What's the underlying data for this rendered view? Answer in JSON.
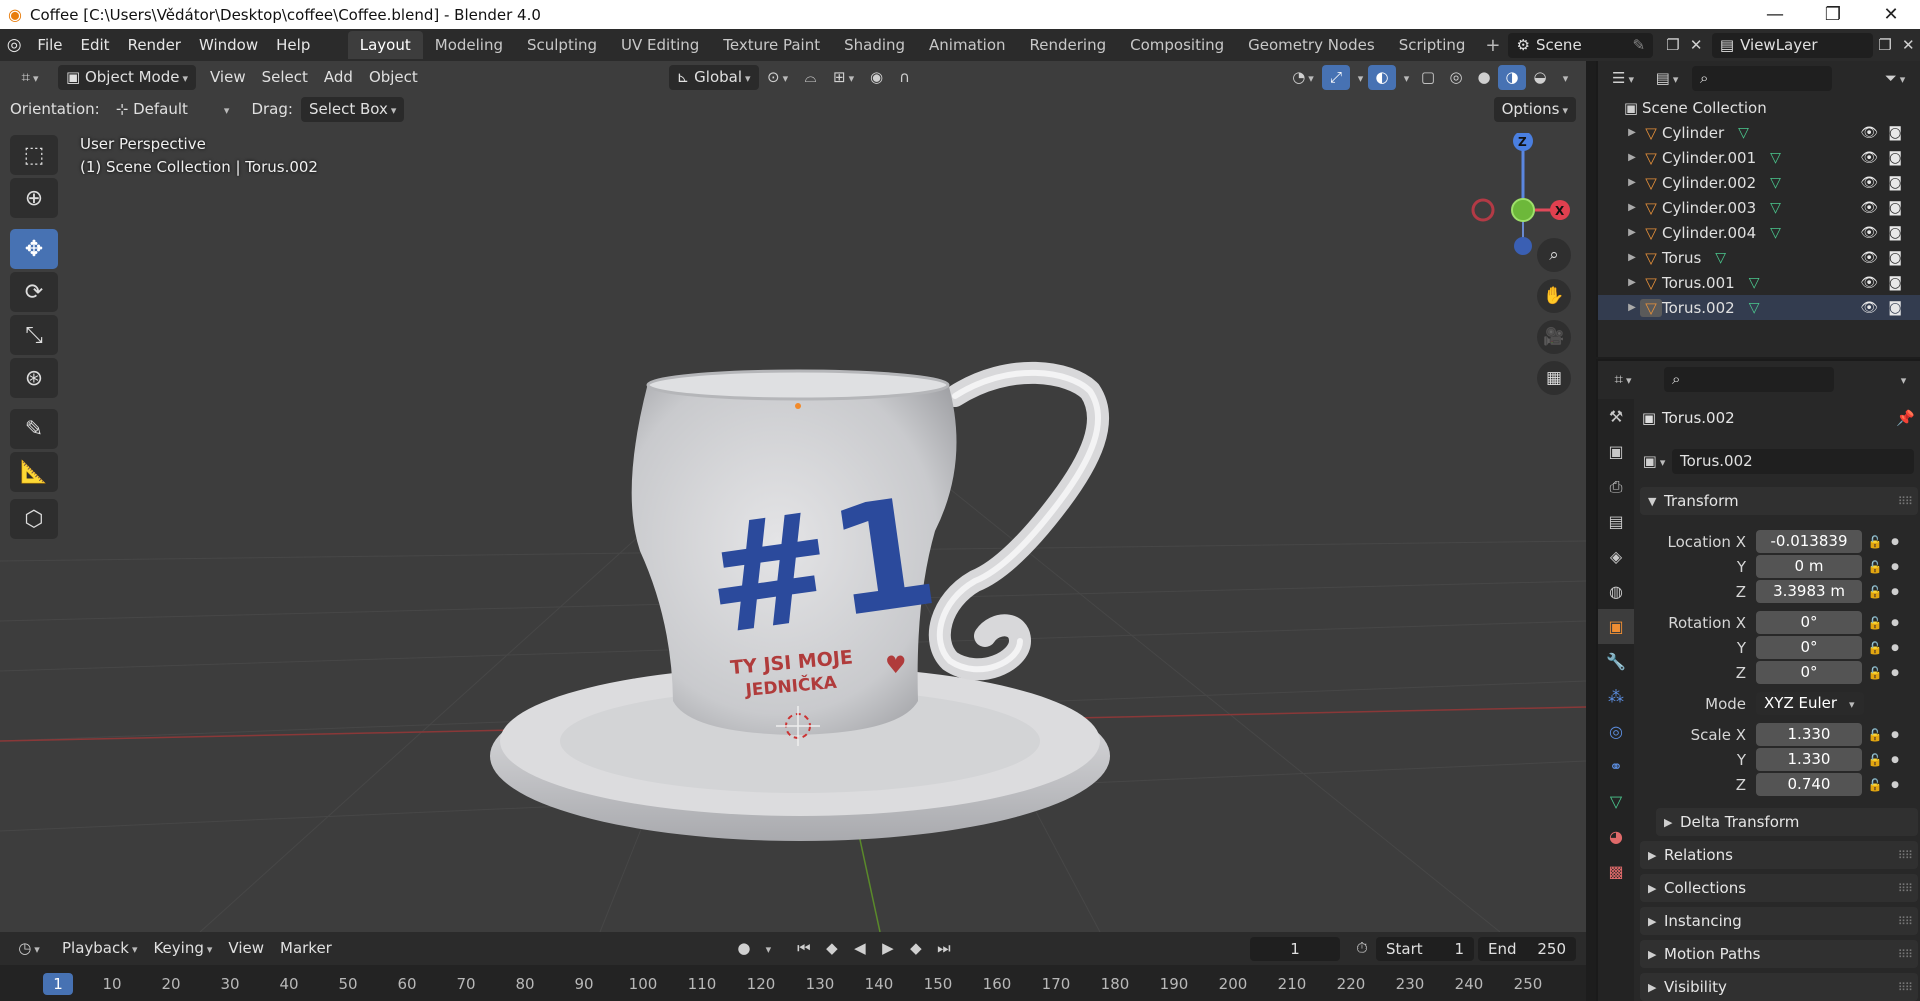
{
  "window": {
    "title": "Coffee [C:\\Users\\Vědátor\\Desktop\\coffee\\Coffee.blend] - Blender 4.0",
    "minimize": "—",
    "maximize": "❐",
    "close": "✕"
  },
  "topbar": {
    "menus": [
      "File",
      "Edit",
      "Render",
      "Window",
      "Help"
    ],
    "workspaces": [
      "Layout",
      "Modeling",
      "Sculpting",
      "UV Editing",
      "Texture Paint",
      "Shading",
      "Animation",
      "Rendering",
      "Compositing",
      "Geometry Nodes",
      "Scripting"
    ],
    "active_workspace": "Layout",
    "scene": "Scene",
    "view_layer": "ViewLayer"
  },
  "viewport": {
    "mode": "Object Mode",
    "menus": [
      "View",
      "Select",
      "Add",
      "Object"
    ],
    "transform_orientation": "Global",
    "orientation_label": "Orientation:",
    "orientation_value": "Default",
    "drag_label": "Drag:",
    "drag_value": "Select Box",
    "options": "Options",
    "overlay_line1": "User Perspective",
    "overlay_line2": "(1) Scene Collection | Torus.002",
    "mug_text_big": "#1",
    "mug_text_line1": "TY JSI MOJE",
    "mug_text_line2": "JEDNIČKA",
    "gizmo_x": "X",
    "gizmo_z": "Z",
    "accent": "#4772b3"
  },
  "timeline": {
    "menus": [
      "Playback",
      "Keying",
      "View",
      "Marker"
    ],
    "current_frame": "1",
    "start_label": "Start",
    "start": "1",
    "end_label": "End",
    "end": "250",
    "ticks": [
      "10",
      "20",
      "30",
      "40",
      "50",
      "60",
      "70",
      "80",
      "90",
      "100",
      "110",
      "120",
      "130",
      "140",
      "150",
      "160",
      "170",
      "180",
      "190",
      "200",
      "210",
      "220",
      "230",
      "240",
      "250"
    ]
  },
  "outliner": {
    "root": "Scene Collection",
    "items": [
      "Cylinder",
      "Cylinder.001",
      "Cylinder.002",
      "Cylinder.003",
      "Cylinder.004",
      "Torus",
      "Torus.001",
      "Torus.002"
    ],
    "selected": "Torus.002"
  },
  "properties": {
    "object_name": "Torus.002",
    "datablock_name": "Torus.002",
    "transform_title": "Transform",
    "location_label": "Location X",
    "location": [
      "-0.013839",
      "0 m",
      "3.3983 m"
    ],
    "rotation_label": "Rotation X",
    "rotation": [
      "0°",
      "0°",
      "0°"
    ],
    "mode_label": "Mode",
    "rotation_mode": "XYZ Euler",
    "scale_label": "Scale X",
    "scale": [
      "1.330",
      "1.330",
      "0.740"
    ],
    "axis_y": "Y",
    "axis_z": "Z",
    "panels": [
      "Delta Transform",
      "Relations",
      "Collections",
      "Instancing",
      "Motion Paths",
      "Visibility"
    ]
  }
}
